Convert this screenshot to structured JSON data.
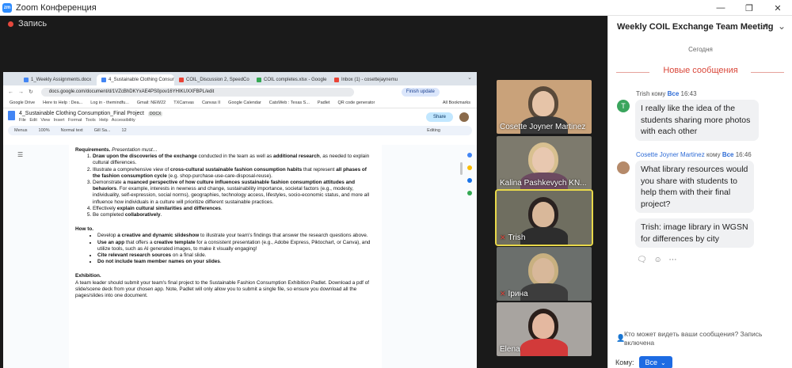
{
  "window": {
    "title": "Zoom Конференция",
    "logo": "zm"
  },
  "recording": {
    "label": "Запись"
  },
  "browser": {
    "tabs": [
      {
        "label": "1_Weekly Assignments.docx",
        "color": "#4285f4"
      },
      {
        "label": "4_Sustainable Clothing Consumption",
        "color": "#4285f4"
      },
      {
        "label": "COIL_Discussion 2, SpeedCo",
        "color": "#e94235"
      },
      {
        "label": "COIL completes.xlsx - Google",
        "color": "#34a853"
      },
      {
        "label": "Inbox (1) - cosettejaynemu",
        "color": "#ea4335"
      }
    ],
    "url": "docs.google.com/document/d/1VZcBhDKYxAE4PS0pov16YHIKUXXFBPL/edit",
    "finish_update": "Finish update",
    "bookmarks": [
      "Google Drive",
      "Here to Help : Dea...",
      "Log in - themindfu...",
      "Gmail: NEW22",
      "TXCanvas",
      "Canvas II",
      "Google Calendar",
      "CatsWeb : Texas S...",
      "Padlet",
      "QR code generator"
    ],
    "all_bookmarks": "All Bookmarks",
    "doc_title": "4_Sustainable Clothing Consumption_Final Project",
    "doc_badge": "DOCX",
    "doc_menus": "File Edit View Insert Format Tools Help Accessibility",
    "share_label": "Share",
    "toolbar": {
      "menus": "Menus",
      "zoom": "100%",
      "style": "Normal text",
      "font": "Gill Sa...",
      "size": "12",
      "editing": "Editing"
    }
  },
  "doc": {
    "req_heading": "Requirements.",
    "req_heading_note": "Presentation must…",
    "req_items": [
      {
        "pre": "",
        "bold": "Draw upon the discoveries of the exchange",
        "mid": " conducted in the team as well as ",
        "bold2": "additional research",
        "post": ", as needed to explain cultural differences."
      },
      {
        "pre": "Illustrate a comprehensive view of ",
        "bold": "cross-cultural sustainable fashion consumption habits",
        "mid": " that represent ",
        "bold2": "all phases of the fashion consumption cycle",
        "post": " (e.g. shop-purchase-use-care-disposal-reuse)."
      },
      {
        "pre": "Demonstrate ",
        "bold": "a nuanced perspective of how culture influences sustainable fashion consumption attitudes and behaviors",
        "mid": ". For example, interests in newness and change, sustainability importance, societal factors (e.g., modesty, individuality, self-expression, social norms), geographies, technology access, lifestyles, socio-economic status, and more all influence how individuals in a culture will prioritize different sustainable practices.",
        "bold2": "",
        "post": ""
      },
      {
        "pre": "Effectively ",
        "bold": "explain cultural similarities and differences",
        "mid": ".",
        "bold2": "",
        "post": ""
      },
      {
        "pre": "Be completed ",
        "bold": "collaboratively",
        "mid": ".",
        "bold2": "",
        "post": ""
      }
    ],
    "how_heading": "How to.",
    "how_items": [
      {
        "pre": "Develop ",
        "bold": "a creative and dynamic slideshow",
        "post": " to illustrate your team's findings that answer the research questions above."
      },
      {
        "pre": "",
        "bold": "Use an app",
        "post": " that offers a ",
        "bold2": "creative template",
        "post2": " for a consistent presentation (e.g., Adobe Express, Piktochart, or Canva), and utilize tools, such as AI generated images, to make it visually engaging!"
      },
      {
        "pre": "",
        "bold": "Cite relevant research sources",
        "post": " on a final slide."
      },
      {
        "pre": "",
        "bold": "Do not include team member names on your slides",
        "post": "."
      }
    ],
    "exhibition_heading": "Exhibition.",
    "exhibition_text": "A team leader should submit your team's final project to the Sustainable Fashion Consumption Exhibition Padlet. Download a pdf of slide/scene deck from your chosen app. Note, Padlet will only allow you to submit a single file, so ensure you download all the pages/slides into one document."
  },
  "participants": [
    {
      "name": "Cosette Joyner Martinez",
      "muted": false,
      "bg": "#c9a27a",
      "skin": "#e6c4a8",
      "hair": "#5a4a3a",
      "shirt": "#3a3a3a",
      "active": false
    },
    {
      "name": "Kalina Pashkevych KN...",
      "muted": false,
      "bg": "#7d7a6d",
      "skin": "#e8c8b0",
      "hair": "#d8c090",
      "shirt": "#6c4a60",
      "active": false
    },
    {
      "name": "Trish",
      "muted": true,
      "bg": "#6f6e60",
      "skin": "#d9b89a",
      "hair": "#2a2220",
      "shirt": "#2d2d2d",
      "active": true
    },
    {
      "name": "Ірина",
      "muted": true,
      "bg": "#6b6f6c",
      "skin": "#d8b89a",
      "hair": "#c8b080",
      "shirt": "#3d3d3d",
      "active": false
    },
    {
      "name": "Elena",
      "muted": false,
      "bg": "#a8a4a0",
      "skin": "#e4b8a0",
      "hair": "#2a1e1a",
      "shirt": "#d23a3a",
      "active": false
    }
  ],
  "chat": {
    "title": "Weekly COIL Exchange Team Meeting",
    "today": "Сегодня",
    "new_messages": "Новые сообщения",
    "messages": [
      {
        "sender": "Trish",
        "to_word": "кому",
        "to": "Все",
        "time": "16:43",
        "avatar_letter": "T",
        "text": "I really like the idea of the students sharing more photos with each other"
      },
      {
        "sender": "Cosette Joyner Martinez",
        "to_word": "кому",
        "to": "Все",
        "time": "16:46",
        "avatar_letter": "",
        "text": "What library resources would you share with students to help them with their final project?"
      },
      {
        "sender": "",
        "to_word": "",
        "to": "",
        "time": "",
        "avatar_letter": "",
        "text": "Trish: image library in WGSN for differences by city"
      }
    ],
    "privacy_text": "Кто может видеть ваши сообщения? Запись включена",
    "to_label": "Кому:",
    "to_value": "Все"
  },
  "colors": {
    "accent": "#2d8cff",
    "record": "#e5483d",
    "new_messages": "#d9473a",
    "active_speaker": "#e8d84a"
  }
}
